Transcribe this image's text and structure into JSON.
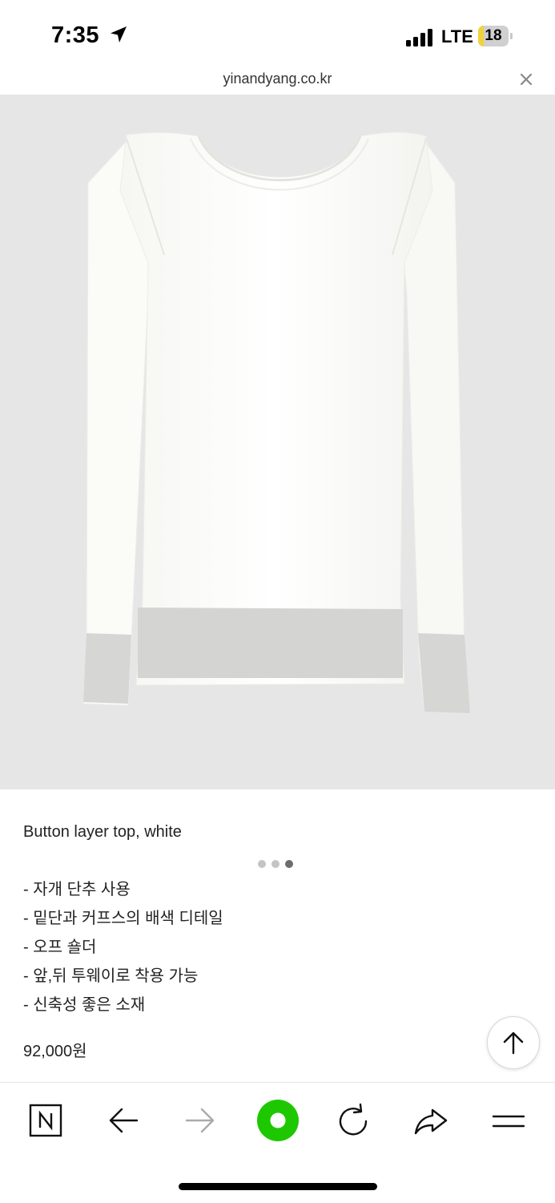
{
  "status_bar": {
    "time": "7:35",
    "network": "LTE",
    "battery": "18",
    "battery_level": 0.18
  },
  "browser": {
    "url": "yinandyang.co.kr"
  },
  "product": {
    "carousel": {
      "count": 3,
      "active_index": 2
    },
    "title": "Button layer top, white",
    "features": [
      "- 자개 단추 사용",
      "- 밑단과 커프스의 배색 디테일",
      "- 오프 숄더",
      "- 앞,뒤 투웨이로 착용 가능",
      "- 신축성 좋은 소재"
    ],
    "price": "92,000원"
  },
  "toolbar": {
    "items": [
      "naver-home-icon",
      "back-arrow-icon",
      "forward-arrow-icon",
      "green-dot-icon",
      "refresh-icon",
      "share-icon",
      "menu-icon"
    ]
  },
  "colors": {
    "accent_green": "#1ec800",
    "image_background": "#e6e6e6",
    "battery_yellow": "#f2d23a"
  }
}
